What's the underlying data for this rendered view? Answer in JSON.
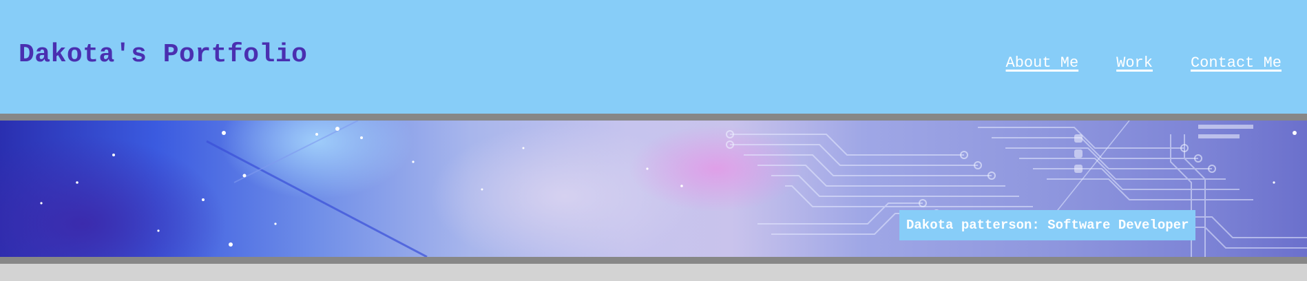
{
  "header": {
    "title": "Dakota's Portfolio",
    "nav": [
      {
        "label": "About Me"
      },
      {
        "label": "Work"
      },
      {
        "label": "Contact Me"
      }
    ]
  },
  "hero": {
    "caption": "Dakota patterson: Software Developer"
  },
  "colors": {
    "header_bg": "#87cdf8",
    "title": "#4a2fb0",
    "nav_link": "#ffffff",
    "separator": "#878787",
    "page_bg": "#d3d3d3",
    "caption_bg": "#87cdf8",
    "caption_text": "#ffffff"
  }
}
